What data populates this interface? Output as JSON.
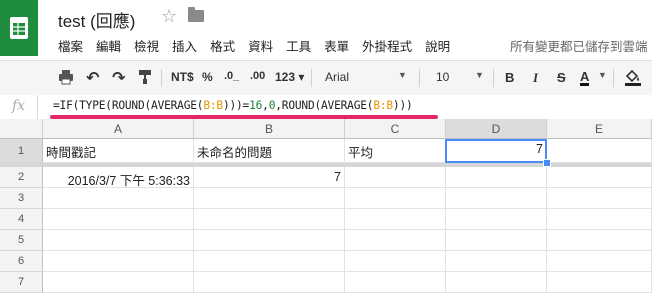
{
  "app": {
    "title": "test (回應)"
  },
  "menu": [
    "檔案",
    "編輯",
    "檢視",
    "插入",
    "格式",
    "資料",
    "工具",
    "表單",
    "外掛程式",
    "說明"
  ],
  "save_status": "所有變更都已儲存到雲端",
  "toolbar": {
    "currency": "NT$",
    "percent": "%",
    "dec_less": ".0_",
    "dec_more": ".00",
    "more_formats": "123 ▾",
    "font": "Arial",
    "font_size": "10",
    "bold": "B",
    "italic": "I",
    "strike": "S",
    "text_color": "A"
  },
  "formula_bar": {
    "fx": "fx",
    "parts": [
      "=IF(TYPE(ROUND(AVERAGE(",
      "B:B",
      ")))=",
      "16",
      ",",
      "0",
      ",ROUND(AVERAGE(",
      "B:B",
      ")))"
    ]
  },
  "columns": [
    "A",
    "B",
    "C",
    "D",
    "E"
  ],
  "rows": [
    "1",
    "2",
    "3",
    "4",
    "5",
    "6",
    "7"
  ],
  "cells": {
    "A1": "時間戳記",
    "B1": "未命名的問題",
    "C1": "平均",
    "D1": "7",
    "A2": "2016/3/7 下午 5:36:33",
    "B2": "7"
  },
  "colors": {
    "accent": "#4a8cf7",
    "highlight": "#e5266b",
    "brand": "#1e8e3e"
  }
}
